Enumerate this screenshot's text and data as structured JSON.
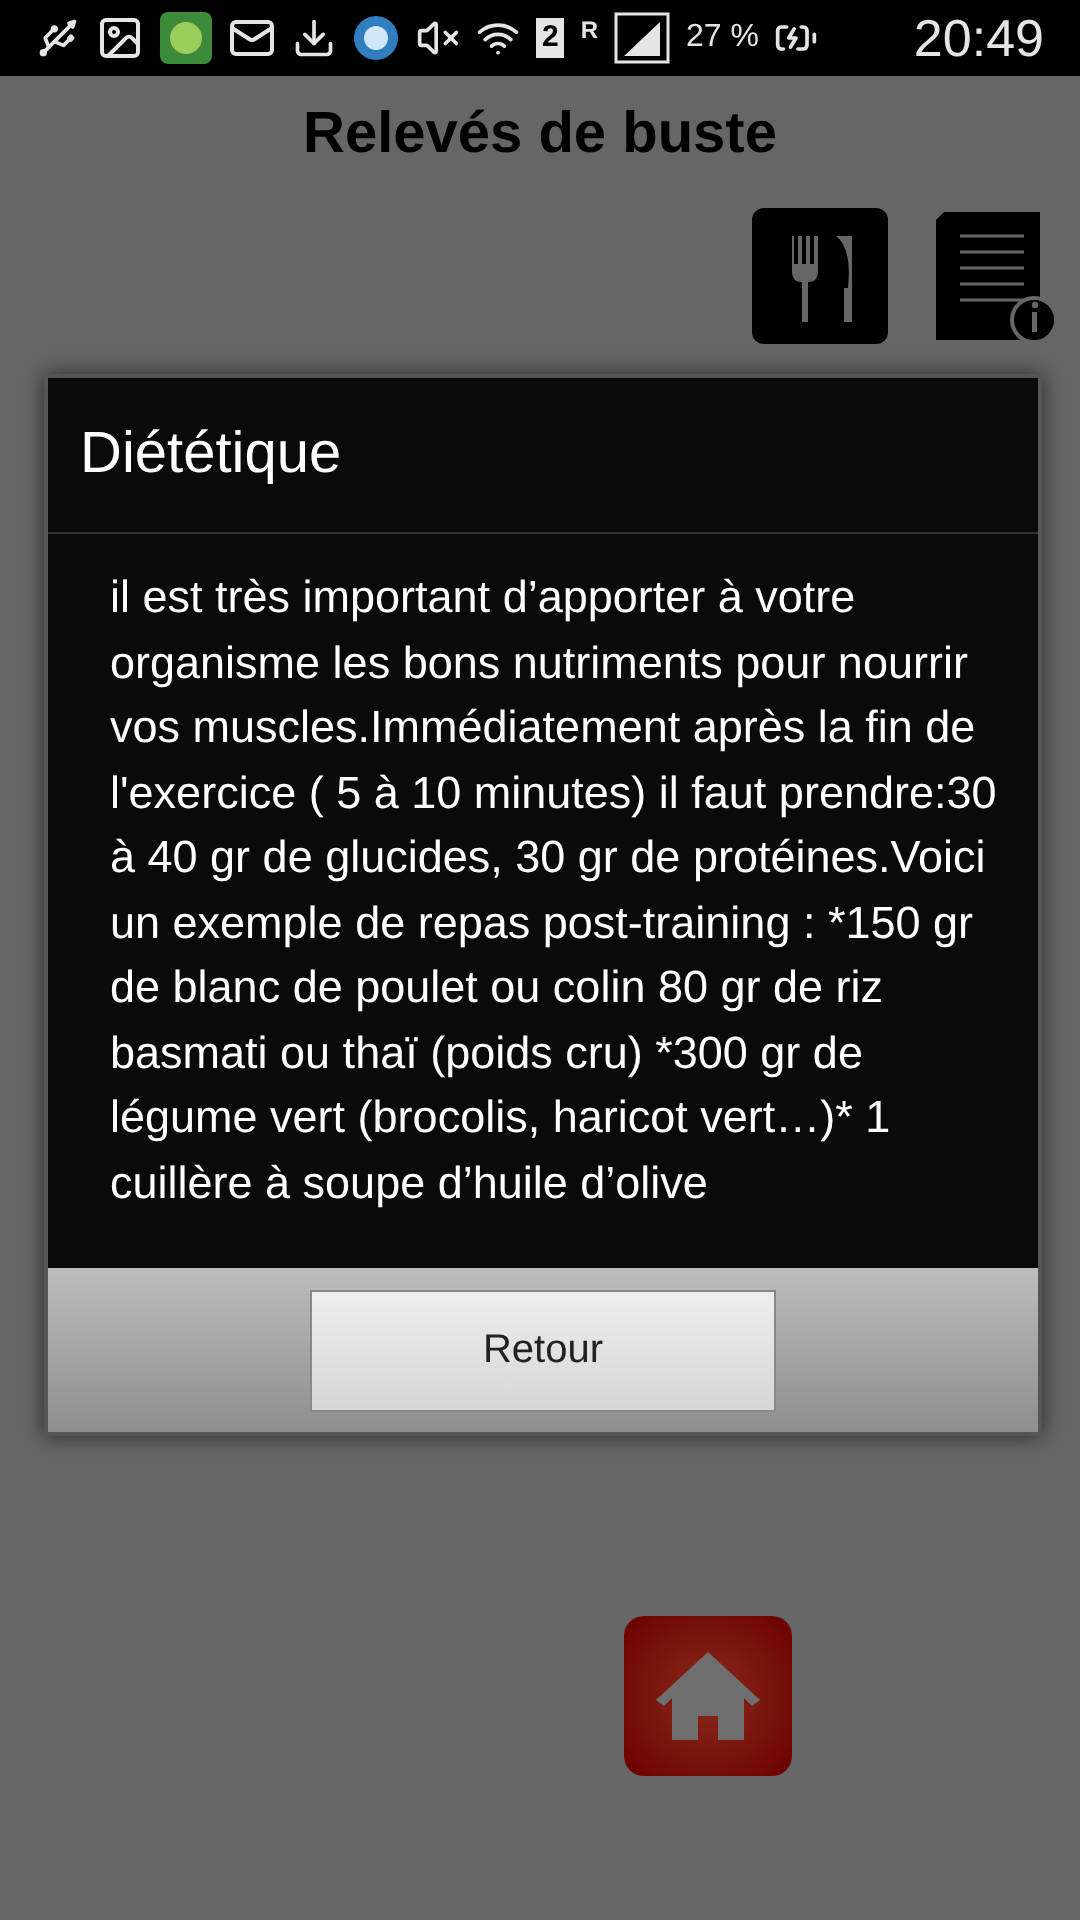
{
  "status_bar": {
    "sim_slot": "2",
    "roaming": "R",
    "battery": "27 %",
    "time": "20:49"
  },
  "page": {
    "title": "Relevés de buste"
  },
  "dialog": {
    "title": "Diététique",
    "message": "il est très important d’apporter à votre organisme les bons nutriments pour nourrir vos muscles.Immédiatement après la fin de l'exercice ( 5 à 10 minutes) il faut prendre:30 à 40 gr de glucides, 30 gr de protéines.Voici un exemple de repas post-training : *150 gr de blanc de poulet ou colin 80 gr de riz basmati ou thaï (poids cru) *300 gr de légume vert (brocolis, haricot vert…)* 1 cuillère à soupe d’huile d’olive",
    "buttons": [
      "Retour"
    ]
  }
}
